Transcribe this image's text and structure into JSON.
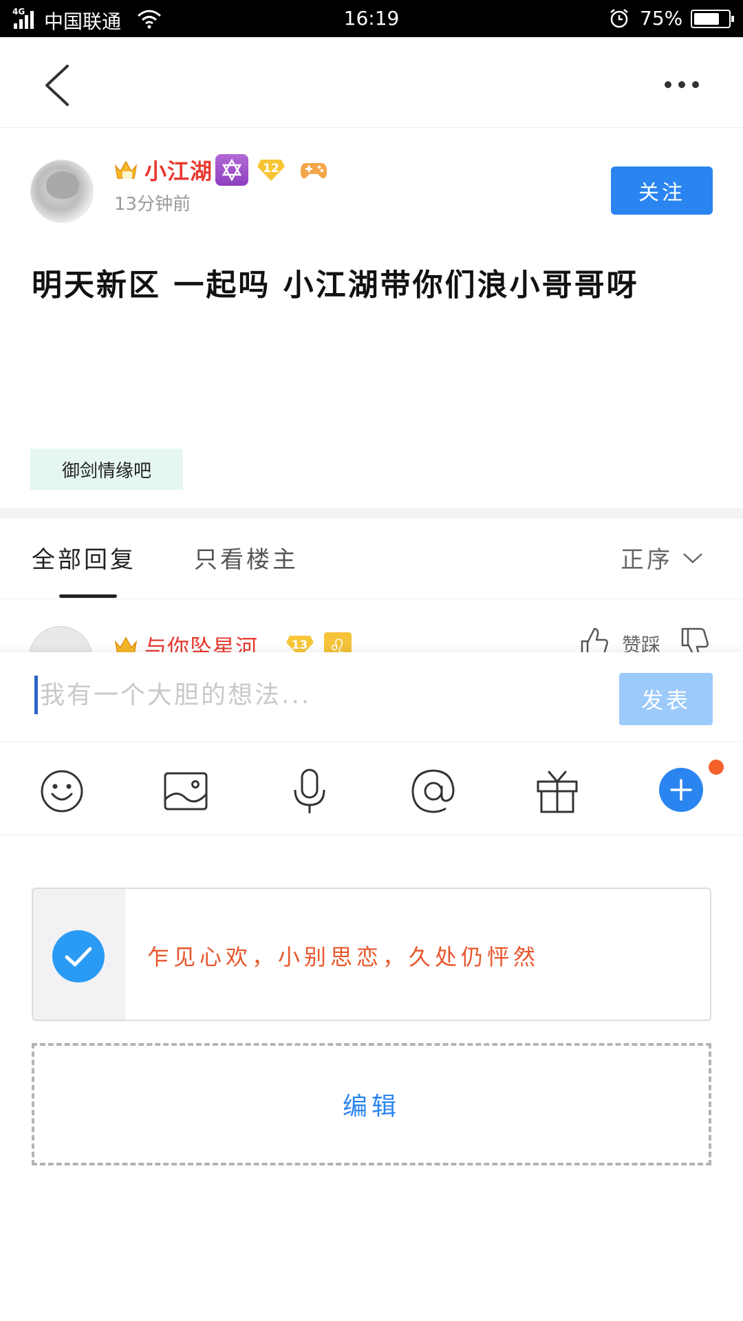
{
  "status_bar": {
    "network": "4G",
    "carrier": "中国联通",
    "time": "16:19",
    "battery": "75%",
    "battery_level": 0.75
  },
  "nav": {
    "back_icon": "chevron-left-icon",
    "more_icon": "more-dots-icon"
  },
  "post": {
    "author": "小江湖",
    "level": "12",
    "time": "13分钟前",
    "follow_label": "关注",
    "content": "明天新区 一起吗 小江湖带你们浪小哥哥呀",
    "forum_tag": "御剑情缘吧"
  },
  "tabs": {
    "all_replies": "全部回复",
    "owner_only": "只看楼主",
    "sort": "正序"
  },
  "reply": {
    "author": "与你坠星河...",
    "level": "13",
    "zodiac": "♌",
    "vote_label": "赞踩"
  },
  "compose": {
    "placeholder": "我有一个大胆的想法...",
    "publish_label": "发表",
    "toolbar": [
      "emoji-icon",
      "image-icon",
      "microphone-icon",
      "at-icon",
      "gift-icon",
      "plus-icon"
    ],
    "signature": "乍见心欢，小别思恋，久处仍怦然",
    "edit_label": "编辑"
  },
  "colors": {
    "accent": "#2b85f0",
    "username_red": "#e8392f",
    "signature_orange": "#e8562b",
    "publish_disabled": "#9ccafb"
  }
}
